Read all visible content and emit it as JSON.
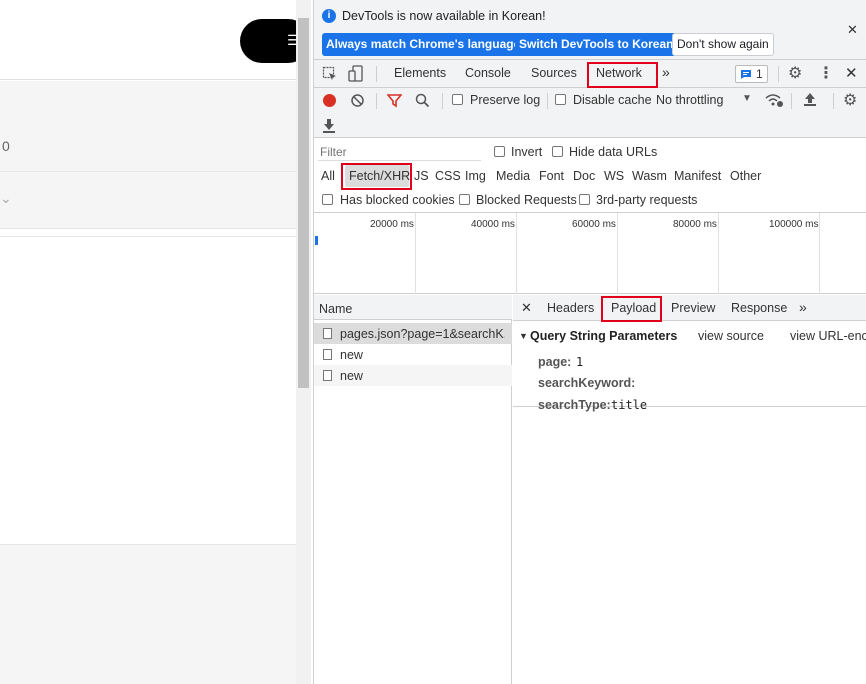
{
  "page": {
    "partial_number": "0",
    "menu_icon": "menu-icon",
    "chevron_icon": "chevron-down-icon"
  },
  "infobar": {
    "message": "DevTools is now available in Korean!",
    "btn_match": "Always match Chrome's language",
    "btn_switch": "Switch DevTools to Korean",
    "btn_dismiss": "Don't show again",
    "close": "✕"
  },
  "tabs": {
    "items": [
      "Elements",
      "Console",
      "Sources",
      "Network"
    ],
    "more": "»",
    "issues_count": "1",
    "active": "Network"
  },
  "toolbar": {
    "preserve_log": "Preserve log",
    "disable_cache": "Disable cache",
    "throttling": "No throttling"
  },
  "filter": {
    "placeholder": "Filter",
    "invert": "Invert",
    "hide_data_urls": "Hide data URLs",
    "types": [
      "All",
      "Fetch/XHR",
      "JS",
      "CSS",
      "Img",
      "Media",
      "Font",
      "Doc",
      "WS",
      "Wasm",
      "Manifest",
      "Other"
    ],
    "selected_type": "Fetch/XHR",
    "has_blocked_cookies": "Has blocked cookies",
    "blocked_requests": "Blocked Requests",
    "third_party": "3rd-party requests"
  },
  "timeline": {
    "ticks": [
      "20000 ms",
      "40000 ms",
      "60000 ms",
      "80000 ms",
      "100000 ms"
    ]
  },
  "requests": {
    "header": "Name",
    "rows": [
      "pages.json?page=1&searchK...",
      "new",
      "new"
    ]
  },
  "detail": {
    "close": "✕",
    "tabs": [
      "Headers",
      "Payload",
      "Preview",
      "Response"
    ],
    "more": "»",
    "active_tab": "Payload",
    "section_title": "Query String Parameters",
    "view_source": "view source",
    "view_url_encoded": "view URL-enco",
    "params": [
      {
        "key": "page:",
        "value": "1"
      },
      {
        "key": "searchKeyword:",
        "value": ""
      },
      {
        "key": "searchType:",
        "value": "title"
      }
    ]
  },
  "colors": {
    "highlight": "#e0001b",
    "accent": "#1a73e8",
    "record": "#d93025"
  }
}
